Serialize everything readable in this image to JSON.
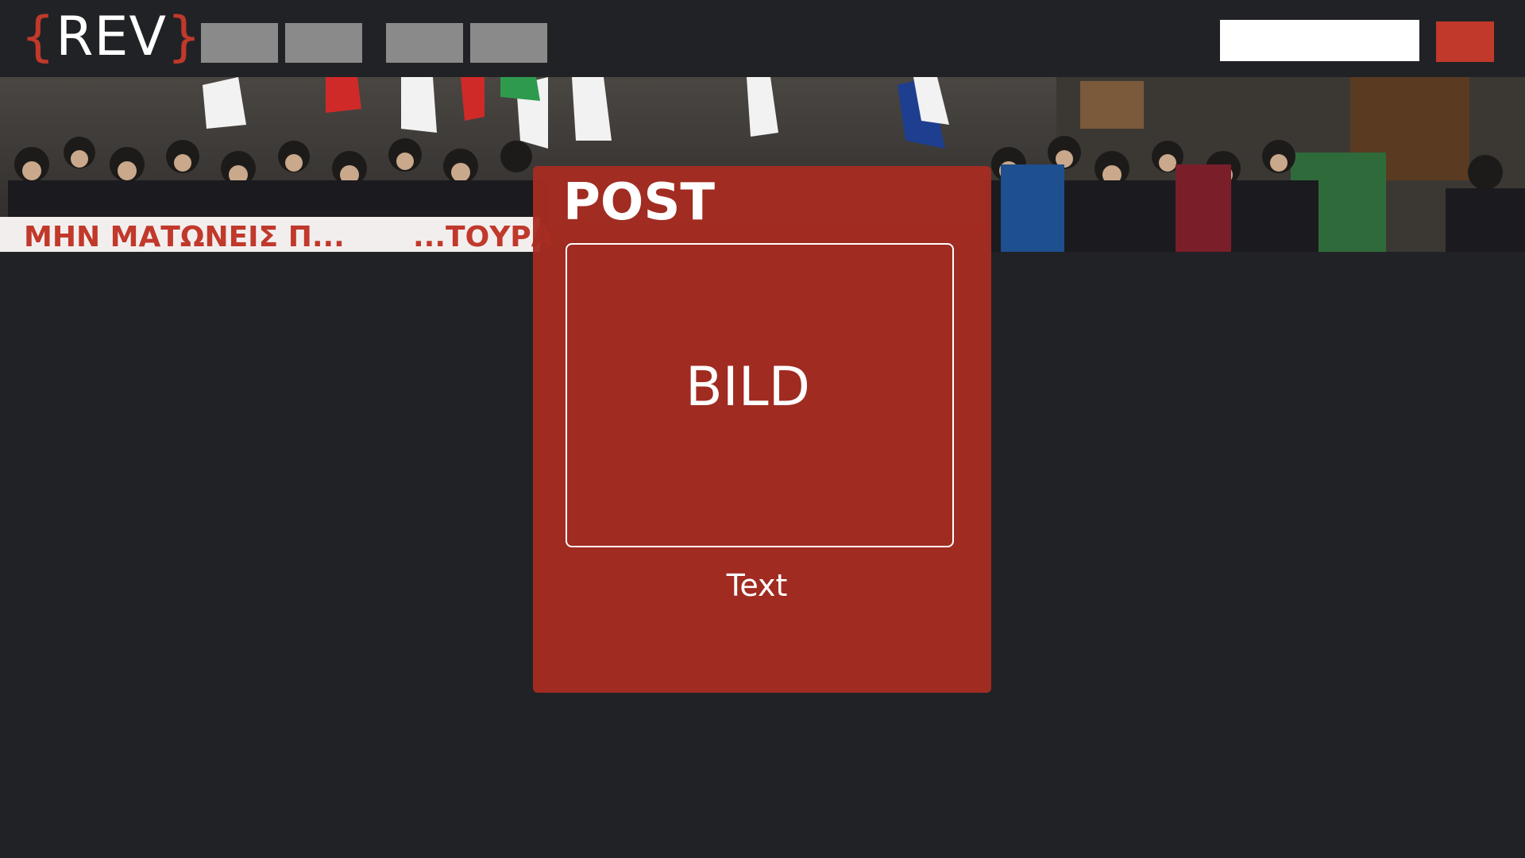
{
  "header": {
    "logo_open": "{",
    "logo_text": "REV",
    "logo_close": "}",
    "nav_count": 4,
    "search_placeholder": "",
    "action_label": ""
  },
  "hero": {
    "image_subject": "street demonstration crowd with flags and banner",
    "banner_text": "ΜΗΝ ΜΑΤΩΝΕΙΣ Π...",
    "banner_text_right": "...ΤΟΥΡΑ"
  },
  "post": {
    "title": "POST",
    "image_label": "BILD",
    "text": "Text"
  },
  "colors": {
    "background": "#212226",
    "accent": "#c0392b",
    "card": "#a62c21",
    "nav_placeholder": "#8a8a8a",
    "search": "#ffffff"
  }
}
